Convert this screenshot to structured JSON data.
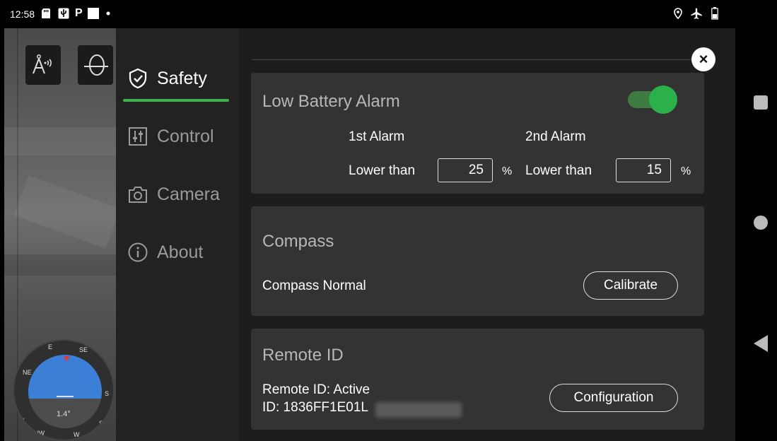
{
  "status_bar": {
    "time": "12:58",
    "icons_left": [
      "sd-card-icon",
      "usb-icon",
      "parking-icon",
      "notification-square-icon",
      "dot-icon"
    ],
    "icons_right": [
      "location-icon",
      "airplane-mode-icon",
      "battery-icon"
    ]
  },
  "camera_view": {
    "compass": {
      "letters": [
        "N",
        "NE",
        "E",
        "SE",
        "S",
        "SW",
        "W",
        "NW"
      ],
      "reading": "1.4°"
    }
  },
  "sidebar": {
    "items": [
      {
        "label": "Safety",
        "icon": "shield-check-icon",
        "active": true
      },
      {
        "label": "Control",
        "icon": "sliders-icon",
        "active": false
      },
      {
        "label": "Camera",
        "icon": "camera-icon",
        "active": false
      },
      {
        "label": "About",
        "icon": "info-icon",
        "active": false
      }
    ],
    "accent_color": "#3fb24a"
  },
  "close_button": {
    "glyph": "×"
  },
  "low_battery": {
    "title": "Low Battery Alarm",
    "toggle_on": true,
    "alarm1_label": "1st Alarm",
    "alarm2_label": "2nd Alarm",
    "lower_than_1": "Lower than",
    "lower_than_2": "Lower than",
    "alarm1_value": "25",
    "alarm2_value": "15",
    "unit": "%"
  },
  "compass_card": {
    "title": "Compass",
    "status": "Compass Normal",
    "button_label": "Calibrate"
  },
  "remote_id": {
    "title": "Remote ID",
    "status": "Remote ID: Active",
    "id_label": "ID: 1836FF1E01L",
    "button_label": "Configuration"
  },
  "colors": {
    "toggle_knob": "#2ab14a",
    "card_bg": "#333333"
  }
}
